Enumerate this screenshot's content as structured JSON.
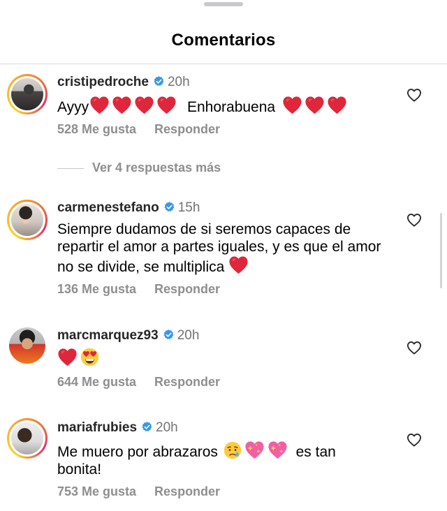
{
  "header": {
    "title": "Comentarios"
  },
  "comments": [
    {
      "username": "cristipedroche",
      "time": "20h",
      "text_before": "Ayyy",
      "text_after": "Enhorabuena",
      "likes": "528 Me gusta",
      "reply": "Responder",
      "view_replies": "Ver 4 respuestas más"
    },
    {
      "username": "carmenestefano",
      "time": "15h",
      "text": "Siempre dudamos de si seremos capaces de repartir el amor a partes iguales, y es que el amor no se divide, se multiplica",
      "likes": "136 Me gusta",
      "reply": "Responder"
    },
    {
      "username": "marcmarquez93",
      "time": "20h",
      "likes": "644 Me gusta",
      "reply": "Responder"
    },
    {
      "username": "mariafrubies",
      "time": "20h",
      "text_before": "Me muero por abrazaros",
      "text_after": "es tan bonita!",
      "likes": "753 Me gusta",
      "reply": "Responder"
    }
  ],
  "colors": {
    "verified": "#3897f0",
    "heart": "#e0263b",
    "muted": "#8e8e8e"
  },
  "icons": [
    "verified-badge-icon",
    "red-heart-emoji",
    "heart-eyes-emoji",
    "crying-face-emoji",
    "sparkling-heart-emoji",
    "like-heart-icon"
  ]
}
